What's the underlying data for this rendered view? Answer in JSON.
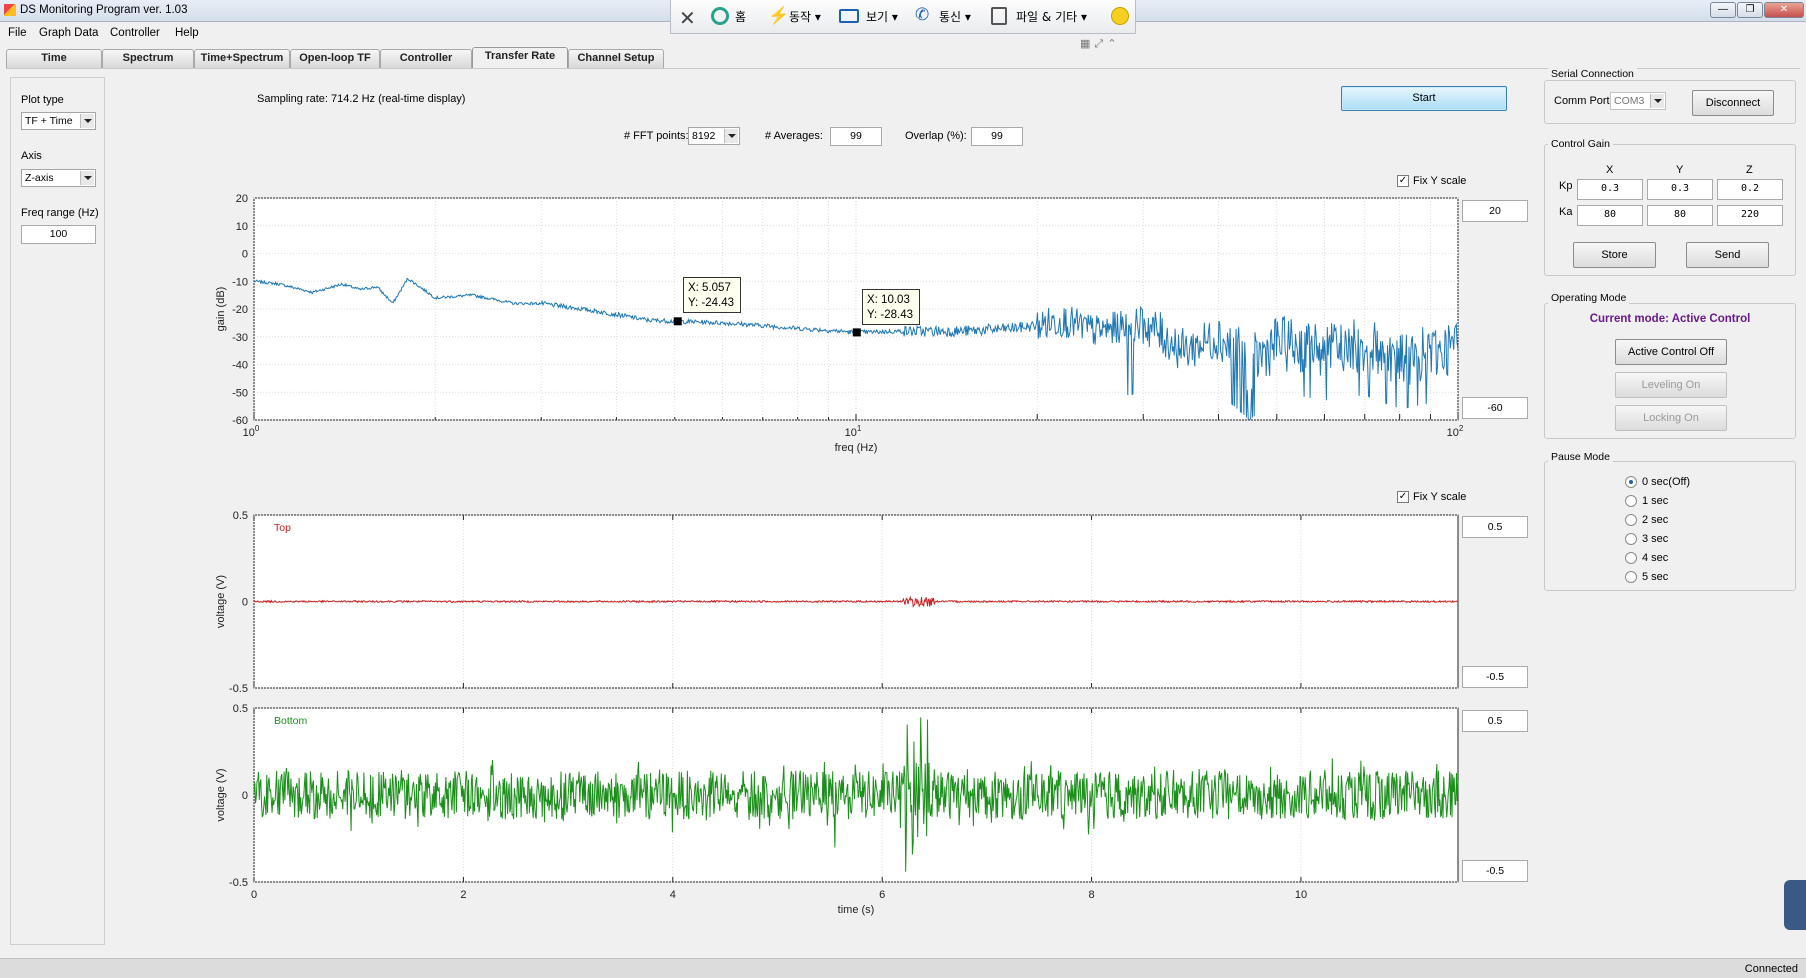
{
  "window": {
    "title": "DS Monitoring Program ver. 1.03",
    "controls": [
      "—",
      "❐",
      "✕"
    ]
  },
  "remote_toolbar": {
    "items": [
      {
        "name": "close",
        "label": ""
      },
      {
        "name": "home",
        "label": "홈"
      },
      {
        "name": "action",
        "label": "동작"
      },
      {
        "name": "view",
        "label": "보기"
      },
      {
        "name": "comm",
        "label": "통신"
      },
      {
        "name": "files",
        "label": "파일 & 기타"
      },
      {
        "name": "emoji",
        "label": ""
      }
    ]
  },
  "menu": [
    "File",
    "Graph Data",
    "Controller",
    "Help"
  ],
  "tabs": [
    "Time",
    "Spectrum",
    "Time+Spectrum",
    "Open-loop TF",
    "Controller",
    "Transfer Rate",
    "Channel Setup"
  ],
  "selected_tab": "Transfer Rate",
  "left_panel": {
    "plot_type_label": "Plot type",
    "plot_type_value": "TF + Time",
    "axis_label": "Axis",
    "axis_value": "Z-axis",
    "freq_range_label": "Freq range (Hz)",
    "freq_range_value": "100"
  },
  "sampling_text": "Sampling rate: 714.2 Hz (real-time display)",
  "start_label": "Start",
  "fft": {
    "points_label": "# FFT points:",
    "points_value": "8192",
    "avg_label": "# Averages:",
    "avg_value": "99",
    "overlap_label": "Overlap (%):",
    "overlap_value": "99"
  },
  "fix_y_label": "Fix Y scale",
  "tf_plot": {
    "y_max": "20",
    "y_min": "-60",
    "datatips": [
      {
        "x_text": "X: 5.057",
        "y_text": "Y: -24.43"
      },
      {
        "x_text": "X: 10.03",
        "y_text": "Y: -28.43"
      }
    ]
  },
  "top_plot": {
    "label": "Top",
    "y_max": "0.5",
    "y_min": "-0.5"
  },
  "bottom_plot": {
    "label": "Bottom",
    "y_max": "0.5",
    "y_min": "-0.5"
  },
  "serial": {
    "title": "Serial Connection",
    "port_label": "Comm Port",
    "port_value": "COM3",
    "disconnect_label": "Disconnect"
  },
  "gain": {
    "title": "Control Gain",
    "cols": [
      "X",
      "Y",
      "Z"
    ],
    "kp_label": "Kp",
    "ka_label": "Ka",
    "kp": [
      "0.3",
      "0.3",
      "0.2"
    ],
    "ka": [
      "80",
      "80",
      "220"
    ],
    "store_label": "Store",
    "send_label": "Send"
  },
  "opmode": {
    "title": "Operating Mode",
    "current": "Current mode: Active Control",
    "active_off_label": "Active Control Off",
    "leveling_label": "Leveling On",
    "locking_label": "Locking On"
  },
  "pause": {
    "title": "Pause Mode",
    "options": [
      "0 sec(Off)",
      "1 sec",
      "2 sec",
      "3 sec",
      "4 sec",
      "5 sec"
    ],
    "selected": 0
  },
  "status": "Connected",
  "colors": {
    "tf": "#1f77b4",
    "top": "#cc2020",
    "bottom": "#1a8f1a",
    "current_mode": "#6a1b8a"
  },
  "chart_data": [
    {
      "type": "line",
      "title": "",
      "xlabel": "freq (Hz)",
      "ylabel": "gain (dB)",
      "xscale": "log",
      "xlim": [
        1,
        100
      ],
      "ylim": [
        -60,
        20
      ],
      "y_ticks": [
        "20",
        "10",
        "0",
        "-10",
        "-20",
        "-30",
        "-40",
        "-50",
        "-60"
      ],
      "x_ticks": [
        {
          "base": "10",
          "exp": "0"
        },
        {
          "base": "10",
          "exp": "1"
        },
        {
          "base": "10",
          "exp": "2"
        }
      ],
      "series": [
        {
          "values_note": "",
          "x": [
            1,
            1.1,
            1.25,
            1.4,
            1.5,
            1.6,
            1.7,
            1.8,
            2,
            2.3,
            2.7,
            3,
            3.5,
            4,
            4.5,
            5.057,
            6,
            7,
            8,
            10.03,
            12,
            15,
            18,
            20,
            22,
            25,
            30,
            35,
            40,
            45,
            50,
            60,
            70,
            80,
            90,
            100
          ],
          "y": [
            -10,
            -11,
            -14,
            -11,
            -13,
            -12,
            -18,
            -9,
            -16,
            -15,
            -18,
            -18,
            -20,
            -22,
            -24,
            -24.43,
            -25,
            -26,
            -27,
            -28.43,
            -28,
            -28,
            -27,
            -26,
            -24,
            -28,
            -25,
            -35,
            -30,
            -40,
            -32,
            -35,
            -33,
            -38,
            -36,
            -33
          ]
        }
      ],
      "grid": true
    },
    {
      "type": "line",
      "title": "",
      "xlabel": "",
      "ylabel": "voltage (V)",
      "xlim": [
        0,
        11.5
      ],
      "ylim": [
        -0.5,
        0.5
      ],
      "y_ticks": [
        "0.5",
        "0",
        "-0.5"
      ],
      "grid": true,
      "series": [
        {
          "name": "Top",
          "x": [
            0,
            6.2,
            6.3,
            6.4,
            11.5
          ],
          "y": [
            0,
            0.02,
            -0.03,
            0.01,
            0
          ]
        }
      ]
    },
    {
      "type": "line",
      "title": "",
      "xlabel": "time (s)",
      "ylabel": "voltage (V)",
      "xlim": [
        0,
        11.5
      ],
      "ylim": [
        -0.5,
        0.5
      ],
      "x_ticks": [
        "0",
        "2",
        "4",
        "6",
        "8",
        "10"
      ],
      "y_ticks": [
        "0.5",
        "0",
        "-0.5"
      ],
      "grid": true,
      "series": [
        {
          "name": "Bottom",
          "x": [
            0,
            11.5
          ],
          "y": [
            0.15,
            -0.15
          ],
          "amplitude": 0.15,
          "peak": [
            6.3,
            0.5,
            -0.5
          ]
        }
      ]
    }
  ]
}
